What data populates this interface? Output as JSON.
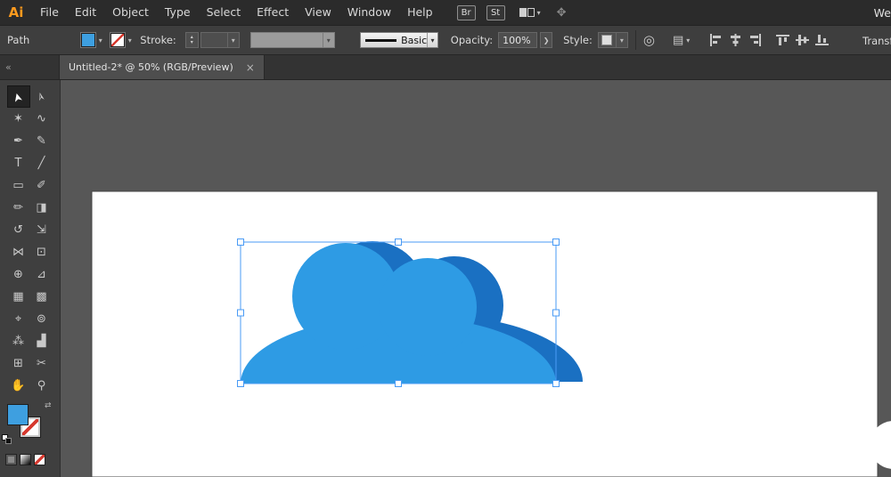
{
  "app": {
    "logo": "Ai",
    "workspace_partial": "We"
  },
  "icons": {
    "caret_down": "▾",
    "stepper_up": "▴",
    "stepper_down": "▾",
    "collapse": "«",
    "swap": "⇄",
    "more": "❯",
    "recolor": "◎",
    "options": "▤",
    "menubar_extra": "✥",
    "close": "×"
  },
  "menubar": {
    "items": [
      "File",
      "Edit",
      "Object",
      "Type",
      "Select",
      "Effect",
      "View",
      "Window",
      "Help"
    ],
    "bridge": "Br",
    "stock": "St"
  },
  "control_bar": {
    "selection_type": "Path",
    "stroke_label": "Stroke:",
    "brush_definition": "Basic",
    "opacity_label": "Opacity:",
    "opacity_value": "100%",
    "style_label": "Style:",
    "transform_label": "Transform"
  },
  "tab_bar": {
    "tabs": [
      {
        "title": "Untitled-2* @ 50% (RGB/Preview)"
      }
    ]
  },
  "toolbar": {
    "tools": [
      {
        "label": "Selection Tool",
        "glyph": "➤"
      },
      {
        "label": "Direct Selection Tool",
        "glyph": "➢"
      },
      {
        "label": "Magic Wand Tool",
        "glyph": "✶"
      },
      {
        "label": "Lasso Tool",
        "glyph": "∿"
      },
      {
        "label": "Pen Tool",
        "glyph": "✒"
      },
      {
        "label": "Curvature Tool",
        "glyph": "✎"
      },
      {
        "label": "Type Tool",
        "glyph": "T"
      },
      {
        "label": "Line Segment Tool",
        "glyph": "╱"
      },
      {
        "label": "Rectangle Tool",
        "glyph": "▭"
      },
      {
        "label": "Paintbrush Tool",
        "glyph": "✐"
      },
      {
        "label": "Shaper Tool",
        "glyph": "✏"
      },
      {
        "label": "Eraser Tool",
        "glyph": "◨"
      },
      {
        "label": "Rotate Tool",
        "glyph": "↺"
      },
      {
        "label": "Scale Tool",
        "glyph": "⇲"
      },
      {
        "label": "Width Tool",
        "glyph": "⋈"
      },
      {
        "label": "Free Transform Tool",
        "glyph": "⊡"
      },
      {
        "label": "Shape Builder Tool",
        "glyph": "⊕"
      },
      {
        "label": "Perspective Grid Tool",
        "glyph": "⊿"
      },
      {
        "label": "Mesh Tool",
        "glyph": "▦"
      },
      {
        "label": "Gradient Tool",
        "glyph": "▩"
      },
      {
        "label": "Eyedropper Tool",
        "glyph": "⌖"
      },
      {
        "label": "Blend Tool",
        "glyph": "⊚"
      },
      {
        "label": "Symbol Sprayer Tool",
        "glyph": "⁂"
      },
      {
        "label": "Column Graph Tool",
        "glyph": "▟"
      },
      {
        "label": "Artboard Tool",
        "glyph": "⊞"
      },
      {
        "label": "Slice Tool",
        "glyph": "✂"
      },
      {
        "label": "Hand Tool",
        "glyph": "✋"
      },
      {
        "label": "Zoom Tool",
        "glyph": "⚲"
      }
    ]
  },
  "canvas": {
    "colors": {
      "canvas_bg": "#575757",
      "artboard": "#FFFFFF",
      "cloud_front": "#2E9BE4",
      "cloud_back": "#1A70C2",
      "selection": "#4A9BF5",
      "handle_fill": "#FFFFFF",
      "white_shape": "#FFFFFF",
      "fill_swatch": "#3E9FE0",
      "stroke_none_red": "#D6392F"
    }
  }
}
